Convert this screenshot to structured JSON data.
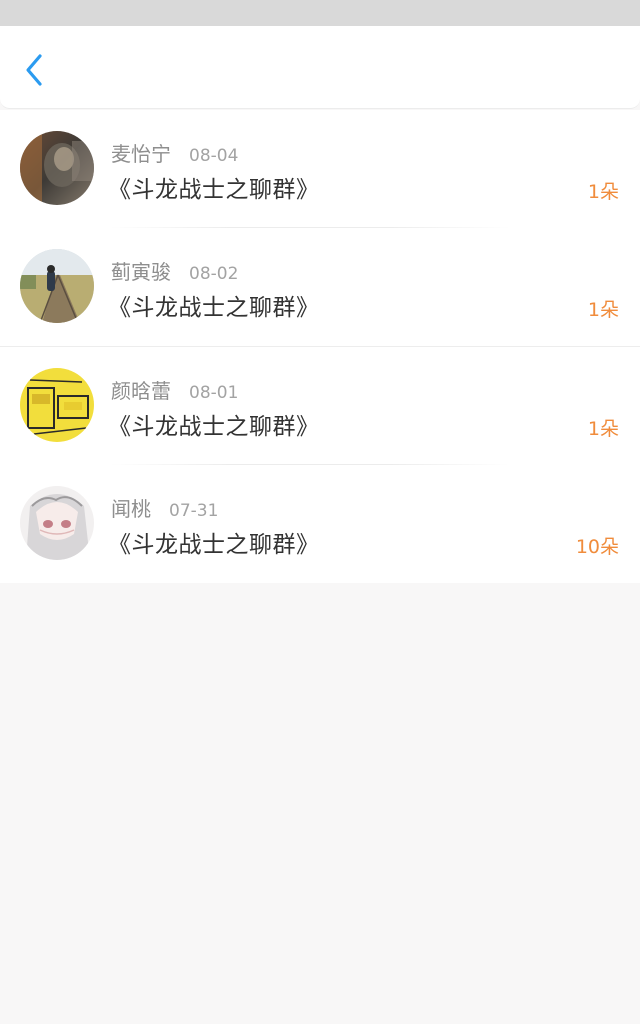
{
  "nav": {
    "back_icon": "chevron-left-icon",
    "accent_color": "#2b9bf0"
  },
  "list": {
    "items": [
      {
        "name": "麦怡宁",
        "date": "08-04",
        "title": "《斗龙战士之聊群》",
        "count": "1朵"
      },
      {
        "name": "蓟寅骏",
        "date": "08-02",
        "title": "《斗龙战士之聊群》",
        "count": "1朵"
      },
      {
        "name": "颜晗蕾",
        "date": "08-01",
        "title": "《斗龙战士之聊群》",
        "count": "1朵"
      },
      {
        "name": "闻桃",
        "date": "07-31",
        "title": "《斗龙战士之聊群》",
        "count": "10朵"
      }
    ]
  },
  "colors": {
    "count": "#f08c3c",
    "name": "#8e8e8e",
    "title": "#333333",
    "background": "#f8f7f7"
  }
}
